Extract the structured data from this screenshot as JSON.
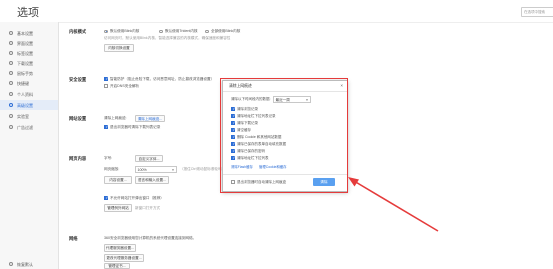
{
  "header": {
    "title": "选项",
    "search_placeholder": "在选项中搜索"
  },
  "sidebar": {
    "items": [
      {
        "label": "基本设置",
        "icon": "home-icon"
      },
      {
        "label": "界面设置",
        "icon": "layout-icon"
      },
      {
        "label": "标签设置",
        "icon": "tag-icon"
      },
      {
        "label": "下载设置",
        "icon": "download-icon"
      },
      {
        "label": "鼠标手势",
        "icon": "mouse-icon"
      },
      {
        "label": "快捷键",
        "icon": "keyboard-icon"
      },
      {
        "label": "个人资料",
        "icon": "user-icon"
      },
      {
        "label": "高级设置",
        "icon": "settings-icon",
        "active": true
      },
      {
        "label": "实验室",
        "icon": "flask-icon"
      },
      {
        "label": "广告过滤",
        "icon": "shield-icon"
      }
    ],
    "bottom_label": "恢复默认"
  },
  "sections": {
    "kernel": {
      "title": "内核模式",
      "options": [
        "默认使用Blink内核",
        "默认使用Trident内核",
        "全部使用Blink内核"
      ],
      "note": "访问网页时，默认使用Blink内核，智能选择兼容的内核模式，确保速度和兼容性",
      "button": "内核切换设置"
    },
    "security": {
      "title": "安全设置",
      "options": [
        "智能防护（阻止危险下载，访问恶意网址，防止篡改浏览器设置）",
        "开启DNS安全解析"
      ]
    },
    "web": {
      "title": "网站设置",
      "item1_label": "清除上网痕迹:",
      "item1_button": "清除上网痕迹...",
      "item2": "退出浏览器时清除下载列表记录"
    },
    "content": {
      "title": "网页内容",
      "font_label": "字号:",
      "font_button": "自定义字体...",
      "zoom_label": "网页缩放:",
      "zoom_value": "100%",
      "zoom_note": "（按住Ctrl滚动鼠标滚轮可改变缩放比例）",
      "content_button": "内容设置...",
      "advanced_button": "语言和输入设置...",
      "popup_option": "不允许网站打开弹出窗口（推荐）",
      "popup_button": "管理例外网站",
      "popup_note": "新窗口打开方式"
    },
    "network": {
      "title": "网络",
      "note": "360安全浏览器使用您计算机的系统代理设置连接到网络。",
      "button1": "代理服务器设置...",
      "button2": "更改代理服务器设置...",
      "button3": "管理证书..."
    }
  },
  "dialog": {
    "title": "清除上网痕迹",
    "range_label": "清除以下时间段内的数据:",
    "range_value": "最近一周",
    "items": [
      {
        "label": "清除浏览记录",
        "checked": true
      },
      {
        "label": "清除地址栏下拉列表记录",
        "checked": true
      },
      {
        "label": "清除下载记录",
        "checked": true
      },
      {
        "label": "清空缓存",
        "checked": true
      },
      {
        "label": "删除 Cookie 和其他网站数据",
        "checked": true
      },
      {
        "label": "清除已保存的表单自动填充数据",
        "checked": true
      },
      {
        "label": "清除已保存的密码",
        "checked": true
      },
      {
        "label": "清除地址栏下拉列表",
        "checked": true
      }
    ],
    "link1": "清除Flash缓存",
    "link2": "管理Cookie和缓存",
    "footer_option": "退出浏览器时自动清除上网痕迹",
    "clear_button": "清除"
  },
  "colors": {
    "accent": "#2c6dd5",
    "annotation": "#e53b3b",
    "primary_button": "#5aa0f0"
  }
}
